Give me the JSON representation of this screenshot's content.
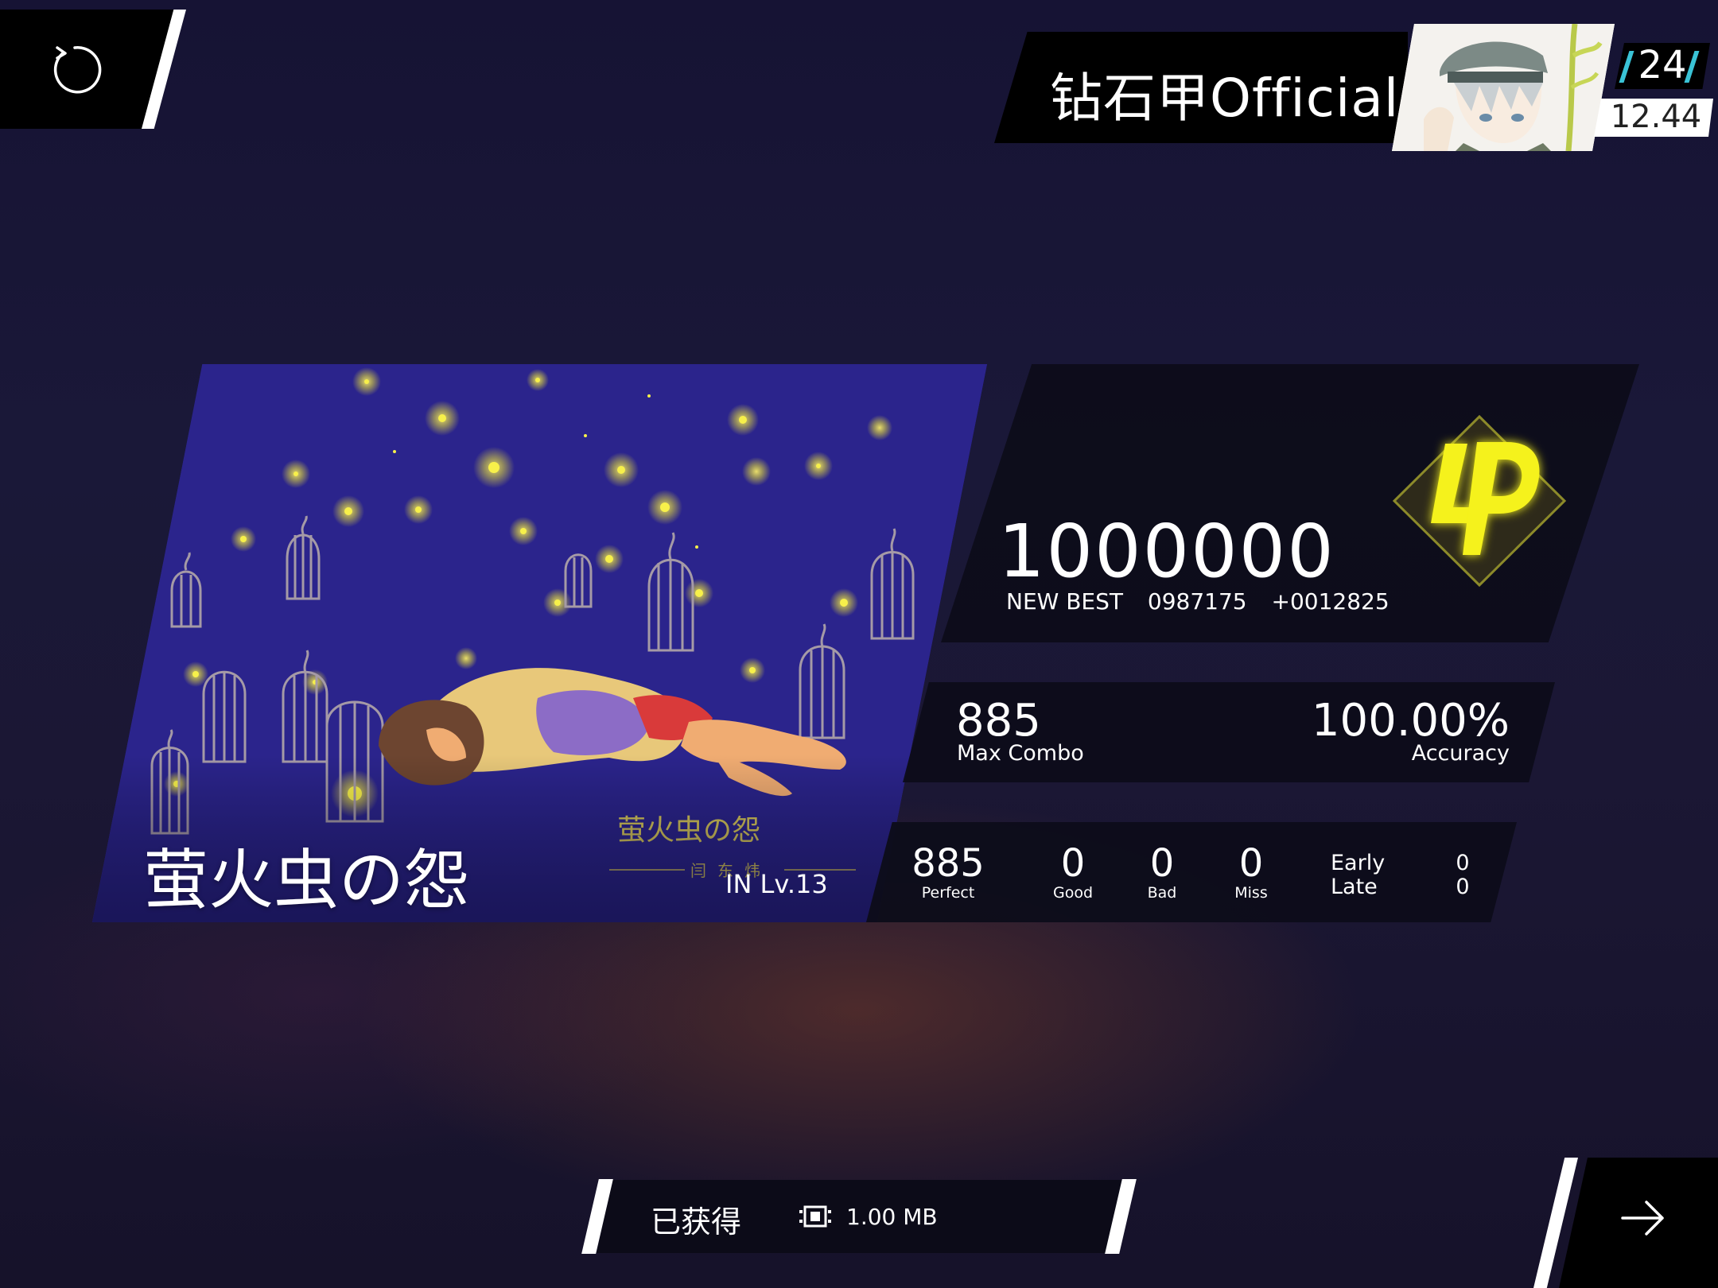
{
  "header": {
    "player_name": "钻石甲Official",
    "rank_number": "24",
    "rks": "12.44"
  },
  "song": {
    "title": "萤火虫の怨",
    "difficulty": "IN Lv.13",
    "art_title": "萤火虫の怨",
    "art_artist": "闫东炜"
  },
  "score": {
    "value": "1000000",
    "new_best_label": "NEW BEST",
    "previous_best": "0987175",
    "delta": "+0012825",
    "grade": "φ",
    "grade_color": "#f5f21a"
  },
  "combo": {
    "max_combo": "885",
    "max_combo_label": "Max Combo",
    "accuracy": "100.00%",
    "accuracy_label": "Accuracy"
  },
  "judgements": {
    "perfect": "885",
    "perfect_label": "Perfect",
    "good": "0",
    "good_label": "Good",
    "bad": "0",
    "bad_label": "Bad",
    "miss": "0",
    "miss_label": "Miss",
    "early_label": "Early",
    "early": "0",
    "late_label": "Late",
    "late": "0"
  },
  "footer": {
    "obtained_label": "已获得",
    "data_icon": "chip-icon",
    "data_amount": "1.00 MB"
  },
  "icons": {
    "retry": "retry-icon",
    "next": "arrow-right-icon"
  },
  "colors": {
    "background": "#1a1838",
    "accent_cyan": "#3ac3d6",
    "grade_yellow": "#f5f21a"
  }
}
